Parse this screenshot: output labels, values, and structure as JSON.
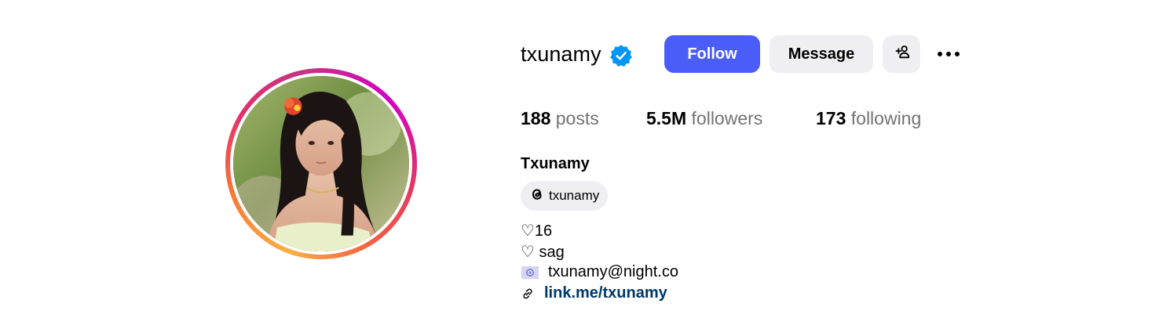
{
  "profile": {
    "username": "txunamy",
    "verified_icon": "verified-badge-icon",
    "full_name": "Txunamy",
    "threads_handle": "txunamy"
  },
  "actions": {
    "follow_label": "Follow",
    "message_label": "Message",
    "add_user_icon": "add-user-icon",
    "more_icon": "more-options-icon"
  },
  "stats": {
    "posts_count": "188",
    "posts_label": "posts",
    "followers_count": "5.5M",
    "followers_label": "followers",
    "following_count": "173",
    "following_label": "following"
  },
  "bio": {
    "line1": "♡16",
    "line2": "♡ sag",
    "line3": "txunamy@night.co",
    "link": "link.me/txunamy"
  },
  "colors": {
    "follow_button": "#4a5df9",
    "secondary_button": "#efeff3",
    "verified": "#0095f6",
    "link": "#00376b",
    "muted_text": "#737373"
  }
}
